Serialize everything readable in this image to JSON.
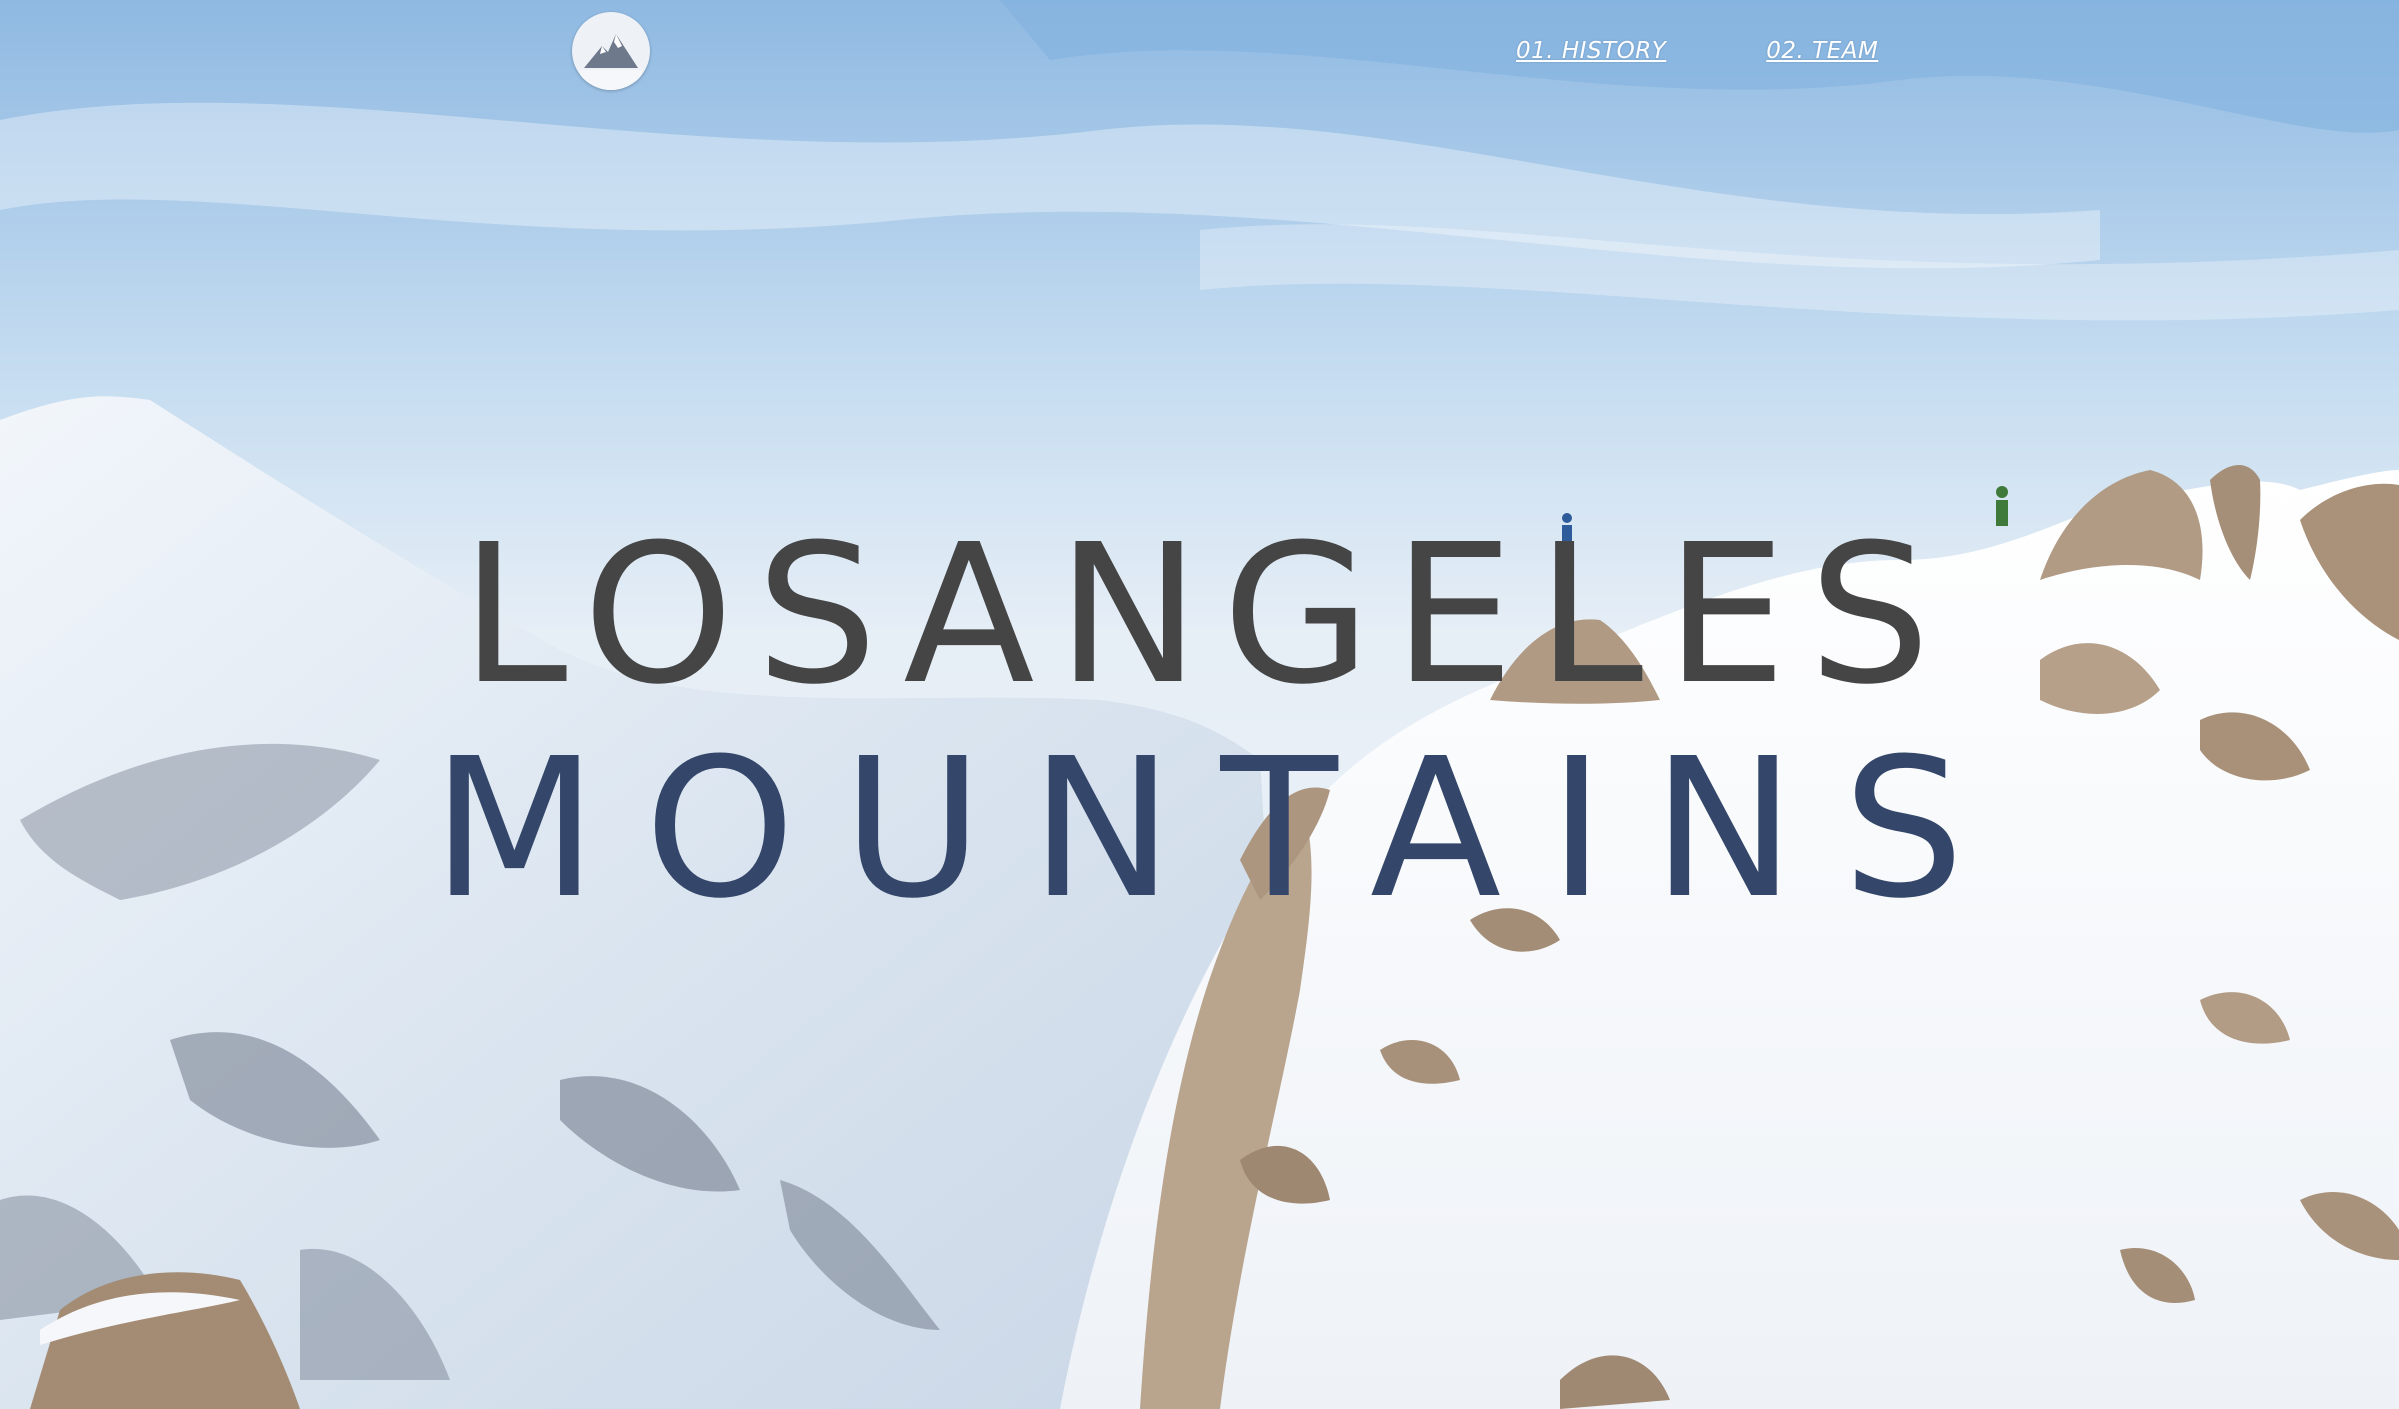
{
  "logo": {
    "icon": "mountain-icon"
  },
  "nav": {
    "items": [
      {
        "label": "01. HISTORY"
      },
      {
        "label": "02. TEAM"
      }
    ]
  },
  "hero": {
    "title_line1": "LOSANGELES",
    "title_line2": "MOUNTAINS"
  },
  "colors": {
    "title_line1": "#454545",
    "title_line2": "#34476a",
    "nav_text": "#ffffff",
    "sky": "#9fc3e6",
    "snow": "#f4f7fb",
    "rock": "#b09a83"
  }
}
